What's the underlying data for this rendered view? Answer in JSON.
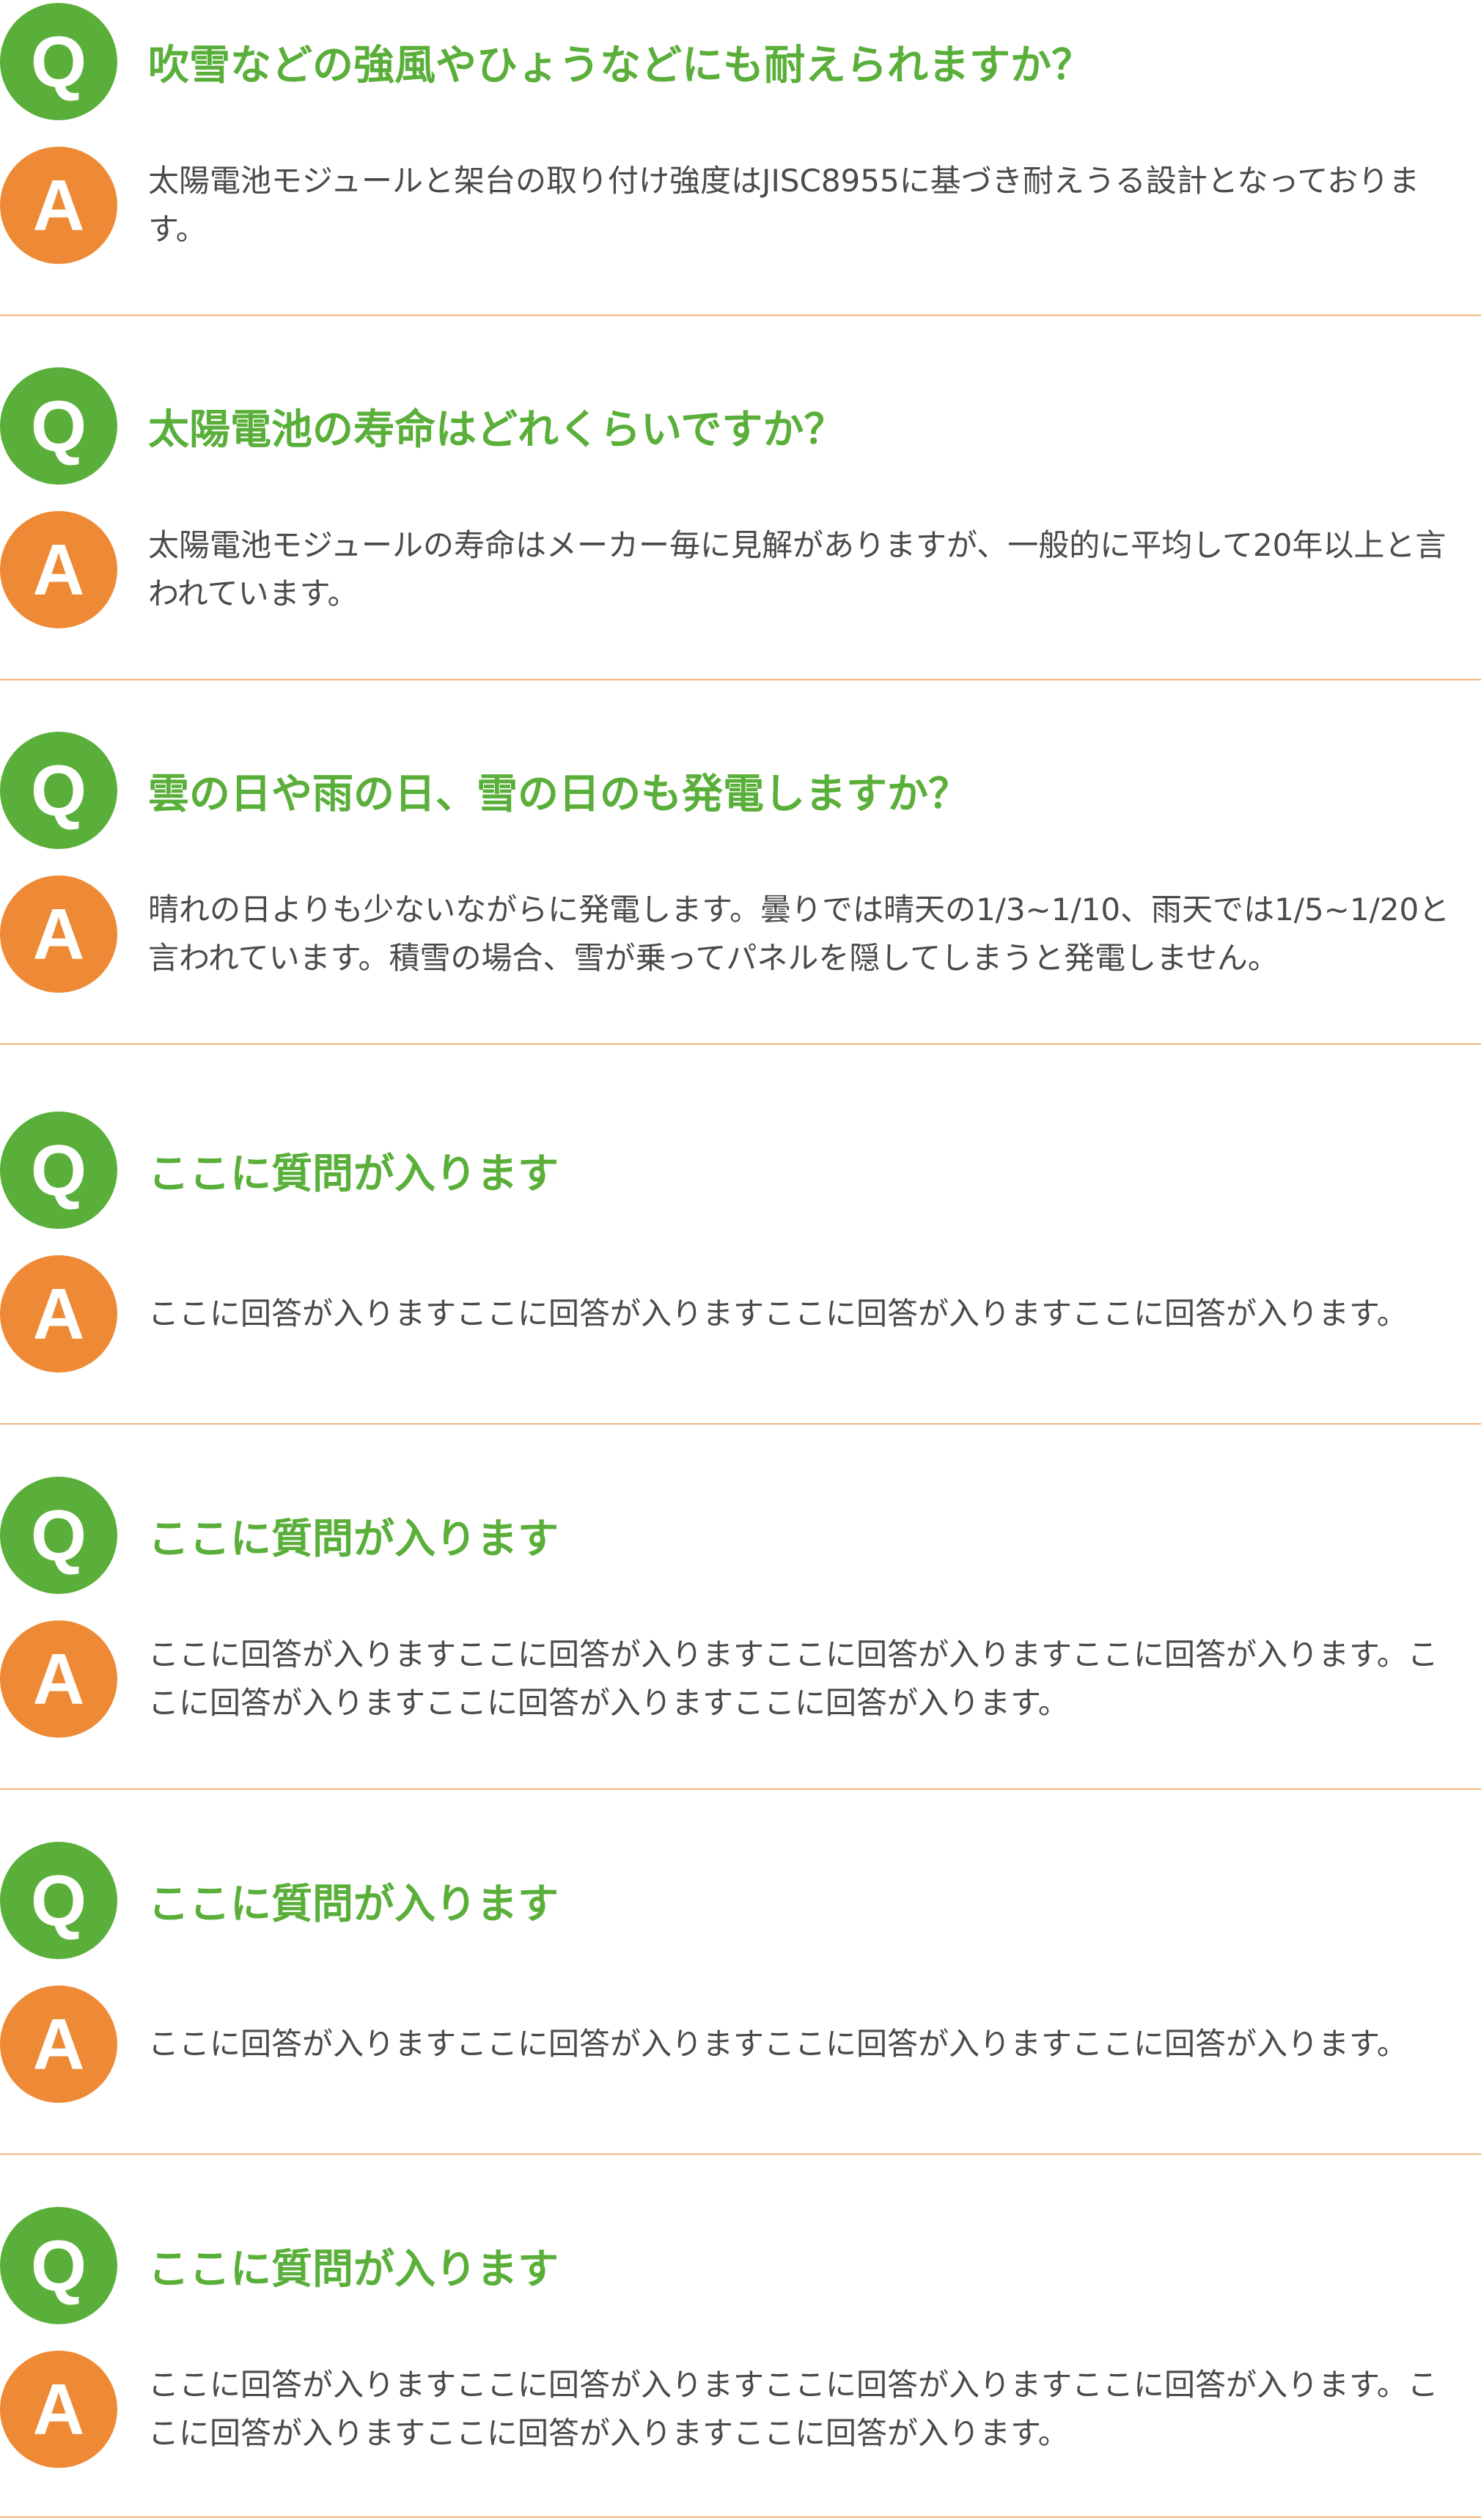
{
  "badges": {
    "question_letter": "Q",
    "answer_letter": "A",
    "question_color": "#5aaf3a",
    "answer_color": "#ee8a35"
  },
  "faq": [
    {
      "question": "吹雪などの強風やひょうなどにも耐えられますか？",
      "answer": "太陽電池モジュールと架台の取り付け強度はJISC8955に基づき耐えうる設計となっております。"
    },
    {
      "question": "太陽電池の寿命はどれくらいですか？",
      "answer": "太陽電池モジュールの寿命はメーカー毎に見解がありますが、一般的に平均して20年以上と言われています。"
    },
    {
      "question": "雲の日や雨の日、雪の日のも発電しますか？",
      "answer": "晴れの日よりも少ないながらに発電します。曇りでは晴天の1/3~1/10、雨天では1/5~1/20と言われています。積雪の場合、雪が乗ってパネルを隠してしまうと発電しません。"
    },
    {
      "question": "ここに質問が入ります",
      "answer": "ここに回答が入りますここに回答が入りますここに回答が入りますここに回答が入ります。"
    },
    {
      "question": "ここに質問が入ります",
      "answer": "ここに回答が入りますここに回答が入りますここに回答が入りますここに回答が入ります。ここに回答が入りますここに回答が入りますここに回答が入ります。"
    },
    {
      "question": "ここに質問が入ります",
      "answer": "ここに回答が入りますここに回答が入りますここに回答が入りますここに回答が入ります。"
    },
    {
      "question": "ここに質問が入ります",
      "answer": "ここに回答が入りますここに回答が入りますここに回答が入りますここに回答が入ります。ここに回答が入りますここに回答が入りますここに回答が入ります。"
    }
  ]
}
